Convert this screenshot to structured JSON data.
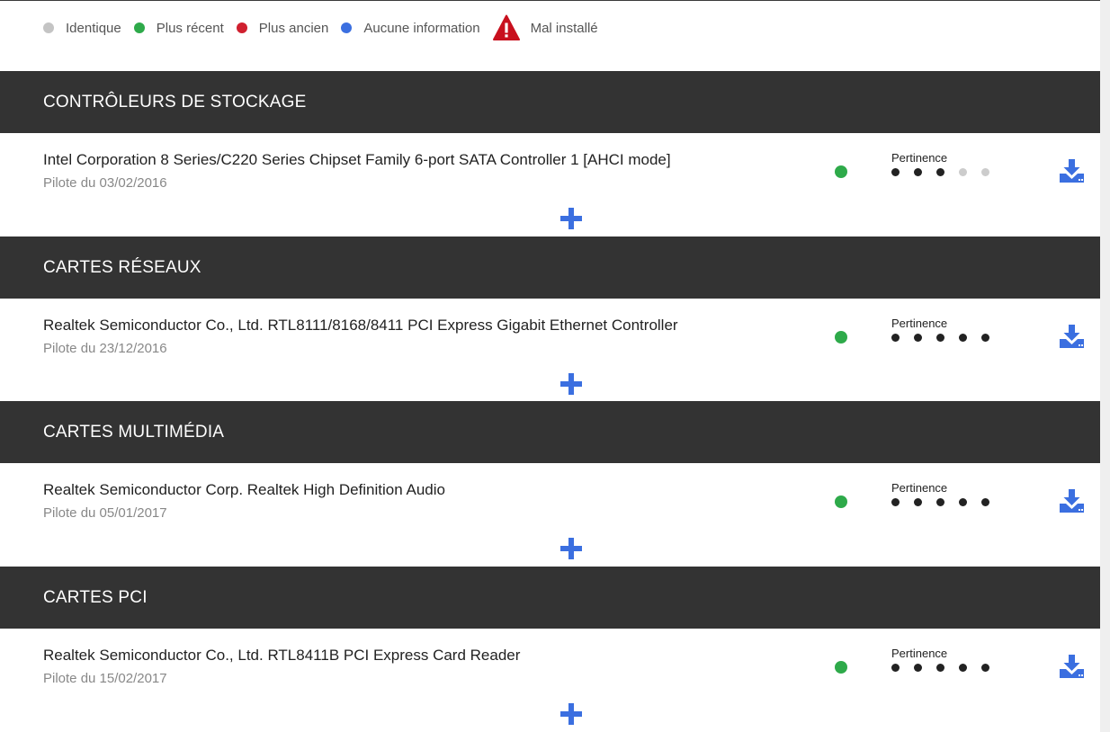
{
  "colors": {
    "identical": "#c4c4c4",
    "newer": "#2eaa4a",
    "older": "#d0202f",
    "no_info": "#3b6fe0",
    "warning": "#c8101e",
    "section_bg": "#333333",
    "accent_blue": "#3b6fe0"
  },
  "legend": {
    "identical": "Identique",
    "newer": "Plus récent",
    "older": "Plus ancien",
    "no_info": "Aucune information",
    "bad_install": "Mal installé"
  },
  "sections": [
    {
      "title": "CONTRÔLEURS DE STOCKAGE",
      "driver": {
        "name": "Intel Corporation 8 Series/C220 Series Chipset Family 6-port SATA Controller 1 [AHCI mode]",
        "date": "Pilote du 03/02/2016",
        "status": "newer",
        "pertinence_label": "Pertinence",
        "pertinence": 3,
        "pertinence_max": 5,
        "icons": {
          "download": "download-icon",
          "expand": "plus-icon"
        }
      }
    },
    {
      "title": "CARTES RÉSEAUX",
      "driver": {
        "name": "Realtek Semiconductor Co., Ltd. RTL8111/8168/8411 PCI Express Gigabit Ethernet Controller",
        "date": "Pilote du 23/12/2016",
        "status": "newer",
        "pertinence_label": "Pertinence",
        "pertinence": 5,
        "pertinence_max": 5,
        "icons": {
          "download": "download-icon",
          "expand": "plus-icon"
        }
      }
    },
    {
      "title": "CARTES MULTIMÉDIA",
      "driver": {
        "name": "Realtek Semiconductor Corp. Realtek High Definition Audio",
        "date": "Pilote du 05/01/2017",
        "status": "newer",
        "pertinence_label": "Pertinence",
        "pertinence": 5,
        "pertinence_max": 5,
        "icons": {
          "download": "download-icon",
          "expand": "plus-icon"
        }
      }
    },
    {
      "title": "CARTES PCI",
      "driver": {
        "name": "Realtek Semiconductor Co., Ltd. RTL8411B PCI Express Card Reader",
        "date": "Pilote du 15/02/2017",
        "status": "newer",
        "pertinence_label": "Pertinence",
        "pertinence": 5,
        "pertinence_max": 5,
        "icons": {
          "download": "download-icon",
          "expand": "plus-icon"
        }
      }
    }
  ]
}
